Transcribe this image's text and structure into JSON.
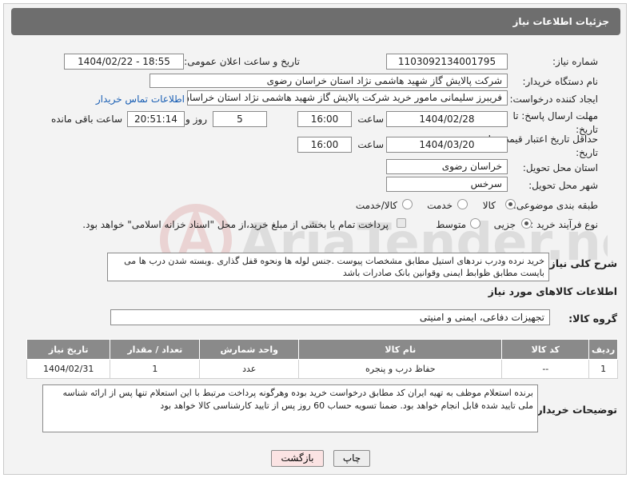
{
  "header": {
    "title": "جزئیات اطلاعات نیاز"
  },
  "fields": {
    "need_number_label": "شماره نیاز:",
    "need_number": "1103092134001795",
    "announce_label": "تاریخ و ساعت اعلان عمومی:",
    "announce_value": "1404/02/22 - 18:55",
    "buyer_org_label": "نام دستگاه خریدار:",
    "buyer_org": "شرکت پالایش گاز شهید هاشمی نژاد   استان خراسان رضوی",
    "requester_label": "ایجاد کننده درخواست:",
    "requester": "فریبرز  سلیمانی مامور خرید شرکت پالایش گاز شهید هاشمی نژاد   استان خراسان رضوی",
    "contact_link": "اطلاعات تماس خریدار",
    "deadline_label": "مهلت ارسال پاسخ: تا تاریخ:",
    "deadline_date": "1404/02/28",
    "time_word": "ساعت",
    "deadline_time": "16:00",
    "days_value": "5",
    "days_word": "روز و",
    "remaining_time": "20:51:14",
    "remaining_word": "ساعت باقی مانده",
    "price_validity_label": "حداقل تاریخ اعتبار قیمت: تا تاریخ:",
    "price_validity_date": "1404/03/20",
    "price_validity_time": "16:00",
    "province_label": "استان محل تحویل:",
    "province": "خراسان رضوی",
    "city_label": "شهر محل تحویل:",
    "city": "سرخس",
    "category_label": "طبقه بندی موضوعی:",
    "category_options": [
      "کالا",
      "خدمت",
      "کالا/خدمت"
    ],
    "process_label": "نوع فرآیند خرید :",
    "process_options": [
      "جزیی",
      "متوسط"
    ],
    "payment_note": "پرداخت تمام یا بخشی از مبلغ خرید،از محل \"اسناد خزانه اسلامی\" خواهد بود."
  },
  "description": {
    "label": "شرح کلی نیاز:",
    "text": "خرید نرده ودرب نردهای استیل مطابق مشخصات پیوست .جنس لوله ها ونحوه قفل گذاری .وبسته شدن درب ها می بایست مطابق ظوابط ایمنی وقوانین بانک صادرات باشد"
  },
  "goods": {
    "section_title": "اطلاعات کالاهای مورد نیاز",
    "group_label": "گروه کالا:",
    "group_value": "تجهیزات دفاعی، ایمنی و امنیتی",
    "columns": [
      "ردیف",
      "کد کالا",
      "نام کالا",
      "واحد شمارش",
      "تعداد / مقدار",
      "تاریخ نیاز"
    ],
    "rows": [
      {
        "row": "1",
        "code": "--",
        "name": "حفاظ درب و پنجره",
        "unit": "عدد",
        "qty": "1",
        "date": "1404/02/31"
      }
    ]
  },
  "buyer_notes": {
    "label": "توضیحات خریدار:",
    "text": "برنده استعلام موظف به تهیه ایران کد مطابق درخواست خرید بوده وهرگونه پرداخت مرتبط با این استعلام تنها پس از ارائه شناسه ملی  تایید شده قابل انجام خواهد بود. ضمنا تسویه حساب 60 روز پس از تایید کارشناسی کالا خواهد بود"
  },
  "buttons": {
    "print": "چاپ",
    "back": "بازگشت"
  },
  "colors": {
    "header_bg": "#6e6e6e",
    "table_header_bg": "#8a8a8a",
    "link": "#1a5fb4",
    "back_button_bg": "#fbe3e3"
  }
}
